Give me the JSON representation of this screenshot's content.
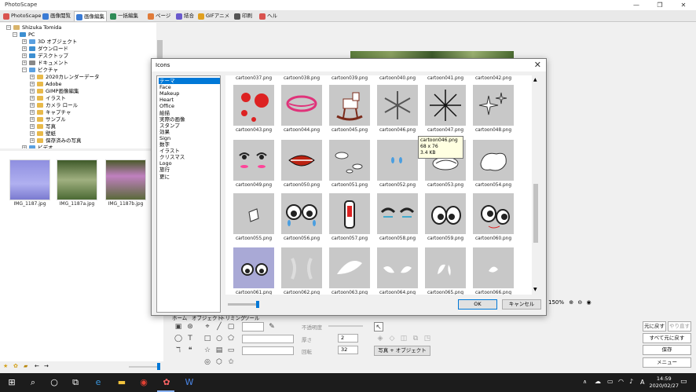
{
  "window": {
    "title": "PhotoScape",
    "controls": [
      "—",
      "❐",
      "✕"
    ]
  },
  "tabs": [
    {
      "label": "PhotoScape",
      "color": "#d9534f"
    },
    {
      "label": "画像閲覧",
      "color": "#3a7bd5"
    },
    {
      "label": "画像編集",
      "color": "#3a7bd5",
      "active": true
    },
    {
      "label": "一括編集",
      "color": "#2e8b57"
    },
    {
      "label": "ページ",
      "color": "#e07b39"
    },
    {
      "label": "結合",
      "color": "#6a5acd"
    },
    {
      "label": "GIFアニメ",
      "color": "#e0a020"
    },
    {
      "label": "印刷",
      "color": "#555555"
    },
    {
      "label": "ヘルプ",
      "color": "#d9534f"
    }
  ],
  "tree": {
    "user": "Shizuka Tomida",
    "pc": "PC",
    "items": [
      "3D オブジェクト",
      "ダウンロード",
      "デスクトップ",
      "ドキュメント",
      "ピクチャ"
    ],
    "sub_items": [
      "2020カレンダーデータ",
      "Adobe",
      "GIMP画像編集",
      "イラスト",
      "カメラ ロール",
      "キャプチャ",
      "サンプル",
      "写真",
      "壁紙",
      "保存済みの写真"
    ],
    "cut_item": "ビデオ"
  },
  "thumbnails": [
    "IMG_1187.jpg",
    "IMG_1187a.jpg",
    "IMG_1187b.jpg"
  ],
  "dialog": {
    "title": "Icons",
    "categories": [
      "テーマ",
      "Face",
      "Makeup",
      "Heart",
      "Office",
      "絵描",
      "実際の画像",
      "スタンプ",
      "効果",
      "Sign",
      "数字",
      "イラスト",
      "クリスマス",
      "Logo",
      "旅行",
      "更に"
    ],
    "selected_category": "テーマ",
    "top_captions": [
      "cartoon037.png",
      "cartoon038.png",
      "cartoon039.png",
      "cartoon040.png",
      "cartoon041.png",
      "cartoon042.png"
    ],
    "rows": [
      [
        "cartoon043.png",
        "cartoon044.png",
        "cartoon045.png",
        "cartoon046.png",
        "cartoon047.png",
        "cartoon048.png"
      ],
      [
        "cartoon049.png",
        "cartoon050.png",
        "cartoon051.png",
        "cartoon052.png",
        "cartoon053.png",
        "cartoon054.png"
      ],
      [
        "cartoon055.png",
        "cartoon056.png",
        "cartoon057.png",
        "cartoon058.png",
        "cartoon059.png",
        "cartoon060.png"
      ],
      [
        "cartoon061.png",
        "cartoon062.png",
        "cartoon063.png",
        "cartoon064.png",
        "cartoon065.png",
        "cartoon066.png"
      ]
    ],
    "tooltip": {
      "name": "cartoon046.png",
      "size": "68 x 76",
      "filesize": "3.4 KB"
    },
    "ok_label": "OK",
    "cancel_label": "キャンセル",
    "close_glyph": "✕"
  },
  "editor": {
    "zoom": "150%",
    "subtabs": [
      "ホーム",
      "オブジェクト",
      "トリミング",
      "ツール"
    ],
    "opacity_label": "不透明度",
    "thickness_label": "厚さ",
    "thickness_value": "2",
    "rotation_label": "回転",
    "rotation_value": "32",
    "photo_object_button": "写真 + オブジェクト",
    "undo": "元に戻す",
    "redo": "やり直す",
    "undo_all": "すべて元に戻す",
    "save": "保存",
    "menu": "メニュー"
  },
  "taskbar": {
    "time": "14:59",
    "date": "2020/02/27",
    "ime": "A"
  }
}
